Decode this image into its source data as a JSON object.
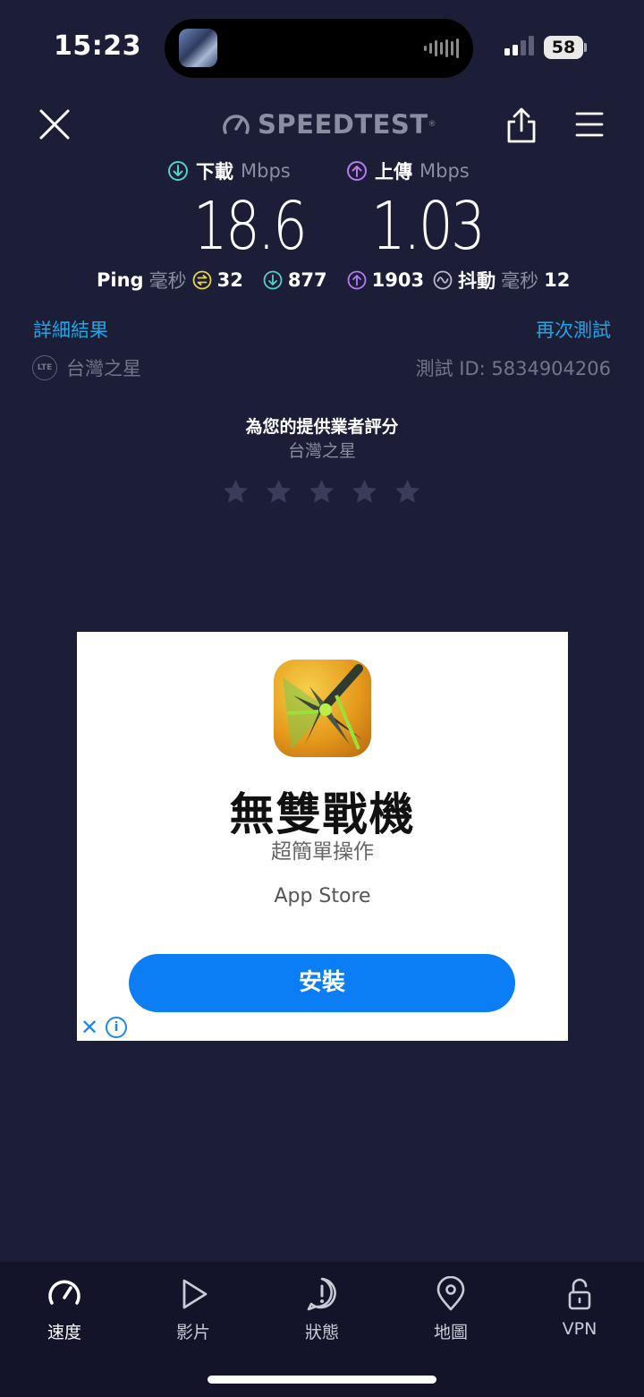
{
  "status_bar": {
    "time": "15:23",
    "battery": "58"
  },
  "header": {
    "logo_text": "SPEEDTEST",
    "logo_mark": "®"
  },
  "results": {
    "download": {
      "label": "下載",
      "unit": "Mbps",
      "value": "18.6",
      "icon": "arrow-down-circle-icon",
      "color": "#4fd1c5"
    },
    "upload": {
      "label": "上傳",
      "unit": "Mbps",
      "value": "1.03",
      "icon": "arrow-up-circle-icon",
      "color": "#b77bf0"
    },
    "ping": {
      "label": "Ping",
      "unit": "毫秒",
      "idle": "32",
      "download_latency": "877",
      "upload_latency": "1903"
    },
    "jitter": {
      "label": "抖動",
      "unit": "毫秒",
      "value": "12"
    }
  },
  "links": {
    "details": "詳細結果",
    "retest": "再次測試"
  },
  "provider": {
    "badge": "LTE",
    "name": "台灣之星",
    "test_id": "測試 ID: 5834904206"
  },
  "rating": {
    "title": "為您的提供業者評分",
    "provider": "台灣之星",
    "stars": 5
  },
  "ad": {
    "title": "無雙戰機",
    "subtitle": "超簡單操作",
    "store": "App Store",
    "install": "安裝"
  },
  "tabs": [
    {
      "label": "速度",
      "icon": "speedometer-icon",
      "active": true
    },
    {
      "label": "影片",
      "icon": "play-icon",
      "active": false
    },
    {
      "label": "狀態",
      "icon": "alert-bubble-icon",
      "active": false
    },
    {
      "label": "地圖",
      "icon": "map-pin-icon",
      "active": false
    },
    {
      "label": "VPN",
      "icon": "lock-icon",
      "active": false
    }
  ],
  "colors": {
    "background": "#1c1d37",
    "accent_link": "#1ea7e8",
    "ping_idle": "#e6d44a",
    "install_button": "#0b7df5"
  }
}
